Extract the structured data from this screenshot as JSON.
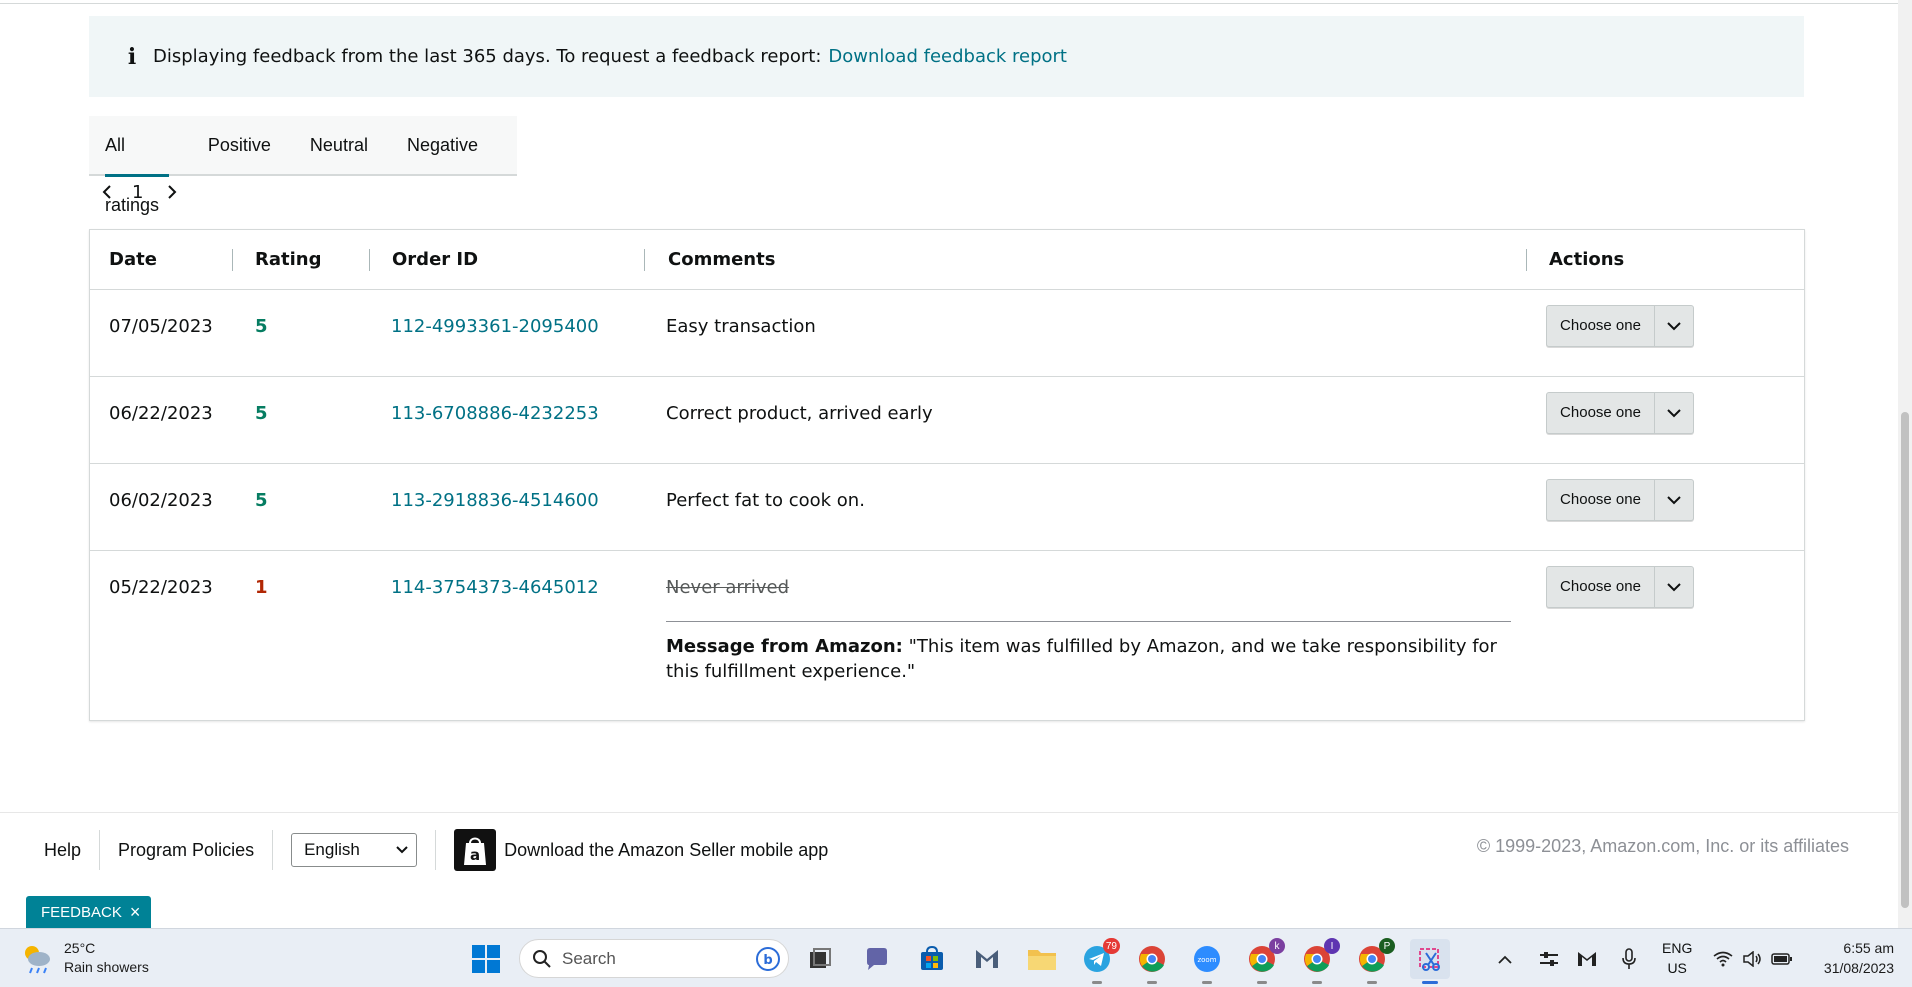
{
  "banner": {
    "text": "Displaying feedback from the last 365 days. To request a feedback report:",
    "link": "Download feedback report"
  },
  "tabs": [
    {
      "label": "All ratings",
      "active": true
    },
    {
      "label": "Positive",
      "active": false
    },
    {
      "label": "Neutral",
      "active": false
    },
    {
      "label": "Negative",
      "active": false
    }
  ],
  "pager": {
    "current": "1"
  },
  "table": {
    "headers": {
      "date": "Date",
      "rating": "Rating",
      "order_id": "Order ID",
      "comments": "Comments",
      "actions": "Actions"
    },
    "rows": [
      {
        "date": "07/05/2023",
        "rating": "5",
        "order_id": "112-4993361-2095400",
        "comment": "Easy transaction",
        "action": "Choose one"
      },
      {
        "date": "06/22/2023",
        "rating": "5",
        "order_id": "113-6708886-4232253",
        "comment": "Correct product, arrived early",
        "action": "Choose one"
      },
      {
        "date": "06/02/2023",
        "rating": "5",
        "order_id": "113-2918836-4514600",
        "comment": "Perfect fat to cook on.",
        "action": "Choose one"
      },
      {
        "date": "05/22/2023",
        "rating": "1",
        "order_id": "114-3754373-4645012",
        "comment": "Never arrived",
        "action": "Choose one",
        "amazon_message_label": "Message from Amazon:",
        "amazon_message": "\"This item was fulfilled by Amazon, and we take responsibility for this fulfillment experience.\""
      }
    ]
  },
  "footer": {
    "help": "Help",
    "policies": "Program Policies",
    "language": "English",
    "app_text": "Download the Amazon Seller mobile app",
    "copyright": "© 1999-2023, Amazon.com, Inc. or its affiliates"
  },
  "feedback_tab": {
    "label": "FEEDBACK"
  },
  "taskbar": {
    "temperature": "25°C",
    "weather": "Rain showers",
    "search_placeholder": "Search",
    "telegram_badge": "79",
    "lang_line1": "ENG",
    "lang_line2": "US",
    "time": "6:55 am",
    "date": "31/08/2023"
  },
  "colors": {
    "link": "#007185",
    "positive": "#067d62",
    "negative": "#b12704",
    "feedback_tab": "#008296"
  }
}
